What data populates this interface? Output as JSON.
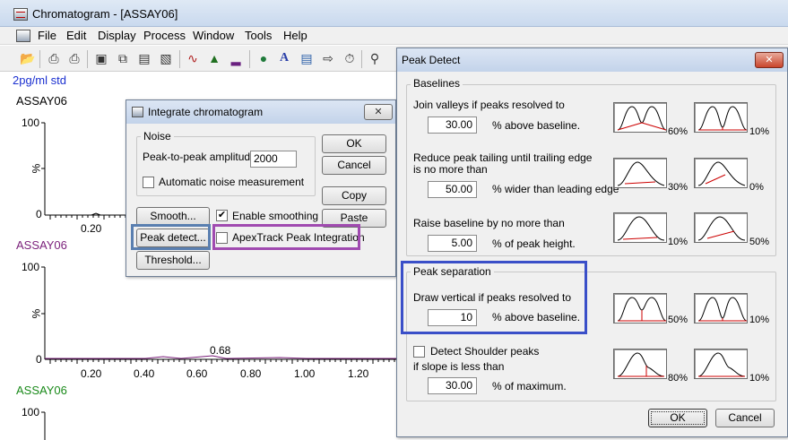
{
  "window": {
    "title": "Chromatogram - [ASSAY06]"
  },
  "menu": [
    "File",
    "Edit",
    "Display",
    "Process",
    "Window",
    "Tools",
    "Help"
  ],
  "toolbar": {
    "icons": [
      "open-icon",
      "print-icon",
      "print-preview-icon",
      "camera-icon",
      "copy-icon",
      "copy-list-icon",
      "paste-icon",
      "chromatogram-icon",
      "peaks-icon",
      "spectrum-icon",
      "globe-icon",
      "text-icon",
      "layout-icon",
      "export-icon",
      "timer-icon",
      "zoom-icon"
    ]
  },
  "chart": {
    "subtitle": "2pg/ml std",
    "traces": [
      {
        "label": "ASSAY06",
        "color": "#000000",
        "ymax": "100",
        "ylabel": "%",
        "ymin": "0",
        "ticks": [
          "0.20"
        ]
      },
      {
        "label": "ASSAY06",
        "color": "#7a1f7a",
        "ymax": "100",
        "ylabel": "%",
        "ymin": "0",
        "peak_label": "0.68",
        "ticks": [
          "0.20",
          "0.40",
          "0.60",
          "0.80",
          "1.00",
          "1.20"
        ]
      },
      {
        "label": "ASSAY06",
        "color": "#1a8a1a",
        "ymax": "100"
      }
    ]
  },
  "integrate": {
    "title": "Integrate chromatogram",
    "noise_group": "Noise",
    "peak_to_peak_label": "Peak-to-peak amplitude",
    "peak_to_peak_value": "2000",
    "auto_noise_label": "Automatic noise measurement",
    "auto_noise_checked": false,
    "ok": "OK",
    "cancel": "Cancel",
    "copy": "Copy",
    "paste": "Paste",
    "smooth": "Smooth...",
    "enable_smoothing_label": "Enable smoothing",
    "enable_smoothing_checked": true,
    "peak_detect": "Peak detect...",
    "apextrack_label": "ApexTrack Peak Integration",
    "apextrack_checked": false,
    "threshold": "Threshold..."
  },
  "peak_detect": {
    "title": "Peak Detect",
    "baselines_group": "Baselines",
    "join_valleys_label": "Join valleys if peaks resolved to",
    "join_valleys_value": "30.00",
    "join_valleys_unit": "% above baseline.",
    "join_thumb_pct_a": "60%",
    "join_thumb_pct_b": "10%",
    "reduce_tailing_label_1": "Reduce peak tailing until trailing edge",
    "reduce_tailing_label_2": "is no more than",
    "reduce_tailing_value": "50.00",
    "reduce_tailing_unit": "% wider than leading edge",
    "tail_thumb_pct_a": "30%",
    "tail_thumb_pct_b": "0%",
    "raise_baseline_label": "Raise baseline by no more than",
    "raise_baseline_value": "5.00",
    "raise_baseline_unit": "% of peak height.",
    "raise_thumb_pct_a": "10%",
    "raise_thumb_pct_b": "50%",
    "separation_group": "Peak separation",
    "draw_vertical_label": "Draw vertical if peaks resolved to",
    "draw_vertical_value": "10",
    "draw_vertical_unit": "% above baseline.",
    "sep_thumb_pct_a": "50%",
    "sep_thumb_pct_b": "10%",
    "shoulder_label": "Detect Shoulder peaks",
    "shoulder_checked": false,
    "slope_label": "if slope is less than",
    "slope_value": "30.00",
    "slope_unit": "% of maximum.",
    "shoulder_thumb_pct_a": "80%",
    "shoulder_thumb_pct_b": "10%",
    "ok": "OK",
    "cancel": "Cancel"
  },
  "highlight_colors": {
    "blue": "#3a4fc8",
    "purple": "#a04ab0",
    "steel": "#5a7fb0"
  }
}
